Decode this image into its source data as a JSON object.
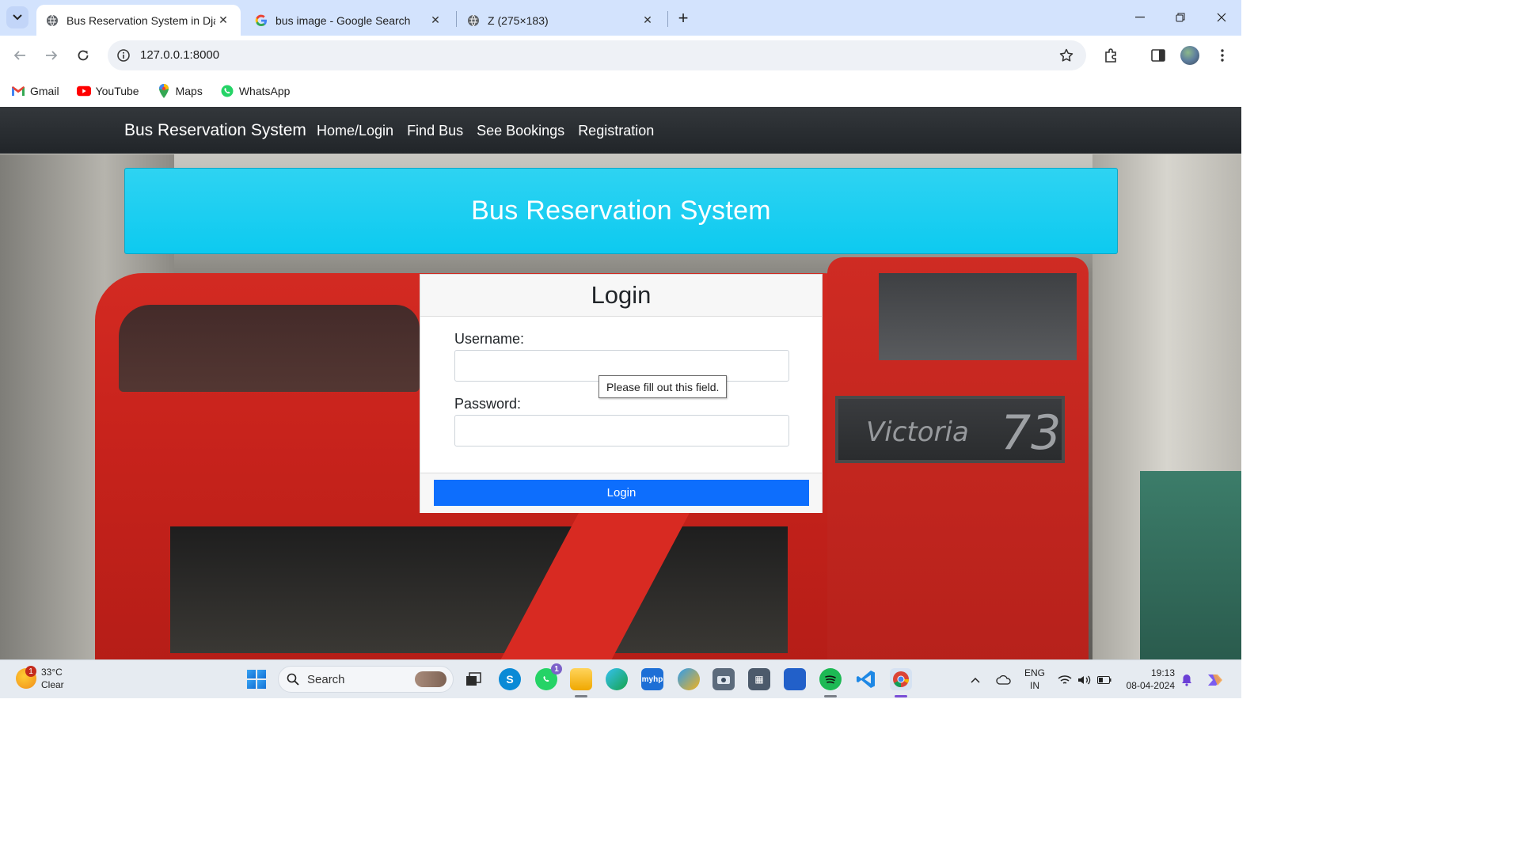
{
  "browser": {
    "tabs": [
      {
        "title": "Bus Reservation System in Djan",
        "active": true
      },
      {
        "title": "bus image - Google Search",
        "active": false
      },
      {
        "title": "Z (275×183)",
        "active": false
      }
    ],
    "url": "127.0.0.1:8000",
    "bookmarks": [
      {
        "label": "Gmail",
        "icon": "gmail-icon"
      },
      {
        "label": "YouTube",
        "icon": "youtube-icon"
      },
      {
        "label": "Maps",
        "icon": "maps-icon"
      },
      {
        "label": "WhatsApp",
        "icon": "whatsapp-icon"
      }
    ]
  },
  "page": {
    "brand": "Bus Reservation System",
    "nav": [
      "Home/Login",
      "Find Bus",
      "See Bookings",
      "Registration"
    ],
    "hero_title": "Bus Reservation System",
    "background": {
      "destination": "Victoria",
      "route_number": "73"
    },
    "login": {
      "title": "Login",
      "username_label": "Username:",
      "password_label": "Password:",
      "username_value": "",
      "password_value": "",
      "validation_message": "Please fill out this field.",
      "submit_label": "Login"
    }
  },
  "taskbar": {
    "weather": {
      "temp": "33°C",
      "condition": "Clear",
      "badge": "1"
    },
    "search_placeholder": "Search",
    "whatsapp_badge": "1",
    "language": {
      "line1": "ENG",
      "line2": "IN"
    },
    "time": "19:13",
    "date": "08-04-2024"
  },
  "colors": {
    "navbar": "#212529",
    "hero": "#0dcaf0",
    "primary_button": "#0d6efd",
    "tabstrip": "#d3e3fd"
  }
}
